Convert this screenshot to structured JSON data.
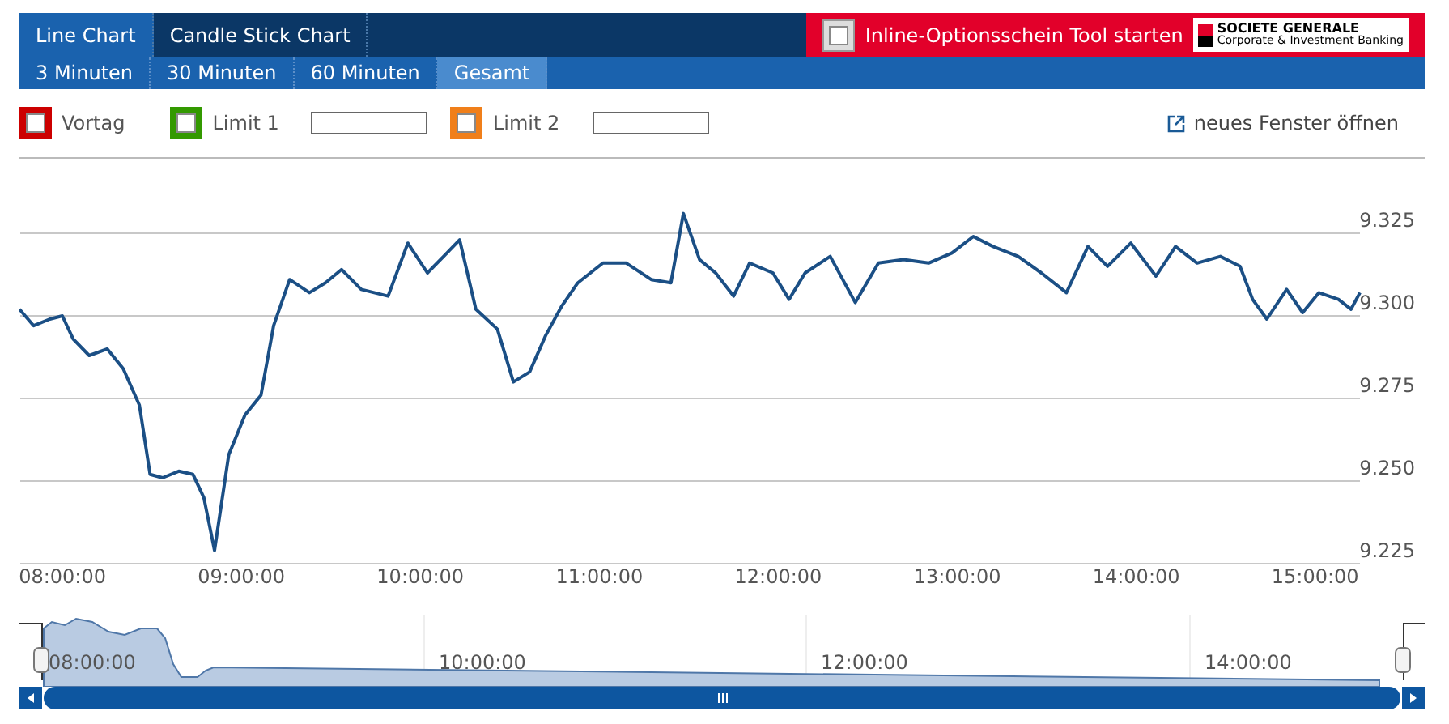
{
  "chart_tabs": [
    {
      "label": "Line Chart",
      "selected": true
    },
    {
      "label": "Candle Stick Chart",
      "selected": false
    }
  ],
  "promo": {
    "label": "Inline-Optionsschein Tool starten",
    "checked": false,
    "logo": {
      "name": "SOCIETE GENERALE",
      "tagline": "Corporate & Investment Banking"
    }
  },
  "ranges": [
    {
      "label": "3 Minuten",
      "selected": false
    },
    {
      "label": "30 Minuten",
      "selected": false
    },
    {
      "label": "60 Minuten",
      "selected": false
    },
    {
      "label": "Gesamt",
      "selected": true
    }
  ],
  "lines": [
    {
      "kind": "plain",
      "label": "Vortag",
      "checked": false,
      "color": "#cc0000"
    },
    {
      "kind": "limit",
      "label": "Limit 1",
      "checked": false,
      "color": "#339900"
    },
    {
      "kind": "limit",
      "label": "Limit 2",
      "checked": false,
      "color": "#f07f1a"
    }
  ],
  "new_window_link": "neues Fenster öffnen",
  "chart_data": {
    "type": "line",
    "grid": true,
    "xlim": [
      7.76,
      15.25
    ],
    "ylim": [
      9.225,
      9.335
    ],
    "xticks": [
      {
        "value": 8,
        "label": "08:00:00"
      },
      {
        "value": 9,
        "label": "09:00:00"
      },
      {
        "value": 10,
        "label": "10:00:00"
      },
      {
        "value": 11,
        "label": "11:00:00"
      },
      {
        "value": 12,
        "label": "12:00:00"
      },
      {
        "value": 13,
        "label": "13:00:00"
      },
      {
        "value": 14,
        "label": "14:00:00"
      },
      {
        "value": 15,
        "label": "15:00:00"
      }
    ],
    "yticks": [
      {
        "value": 9.225,
        "label": "9.225"
      },
      {
        "value": 9.25,
        "label": "9.250"
      },
      {
        "value": 9.275,
        "label": "9.275"
      },
      {
        "value": 9.3,
        "label": "9.300"
      },
      {
        "value": 9.325,
        "label": "9.325"
      }
    ],
    "series": [
      {
        "color": "#1b4f85",
        "x": [
          7.76,
          7.84,
          7.93,
          8.0,
          8.06,
          8.15,
          8.25,
          8.34,
          8.43,
          8.49,
          8.56,
          8.65,
          8.73,
          8.79,
          8.85,
          8.93,
          9.02,
          9.11,
          9.18,
          9.27,
          9.38,
          9.47,
          9.56,
          9.67,
          9.82,
          9.93,
          10.04,
          10.13,
          10.22,
          10.31,
          10.43,
          10.52,
          10.61,
          10.7,
          10.79,
          10.88,
          11.02,
          11.15,
          11.29,
          11.4,
          11.47,
          11.56,
          11.65,
          11.75,
          11.84,
          11.97,
          12.06,
          12.15,
          12.29,
          12.43,
          12.56,
          12.7,
          12.84,
          12.97,
          13.09,
          13.2,
          13.34,
          13.47,
          13.61,
          13.73,
          13.84,
          13.97,
          14.11,
          14.22,
          14.34,
          14.47,
          14.58,
          14.65,
          14.73,
          14.84,
          14.93,
          15.02,
          15.13,
          15.2,
          15.25
        ],
        "values": [
          9.302,
          9.297,
          9.299,
          9.3,
          9.293,
          9.288,
          9.29,
          9.284,
          9.273,
          9.252,
          9.251,
          9.253,
          9.252,
          9.245,
          9.229,
          9.258,
          9.27,
          9.276,
          9.297,
          9.311,
          9.307,
          9.31,
          9.314,
          9.308,
          9.306,
          9.322,
          9.313,
          9.318,
          9.323,
          9.302,
          9.296,
          9.28,
          9.283,
          9.294,
          9.303,
          9.31,
          9.316,
          9.316,
          9.311,
          9.31,
          9.331,
          9.317,
          9.313,
          9.306,
          9.316,
          9.313,
          9.305,
          9.313,
          9.318,
          9.304,
          9.316,
          9.317,
          9.316,
          9.319,
          9.324,
          9.321,
          9.318,
          9.313,
          9.307,
          9.321,
          9.315,
          9.322,
          9.312,
          9.321,
          9.316,
          9.318,
          9.315,
          9.305,
          9.299,
          9.308,
          9.301,
          9.307,
          9.305,
          9.302,
          9.307
        ]
      }
    ]
  },
  "navigator": {
    "labels": [
      "08:00:00",
      "10:00:00",
      "12:00:00",
      "14:00:00"
    ]
  }
}
